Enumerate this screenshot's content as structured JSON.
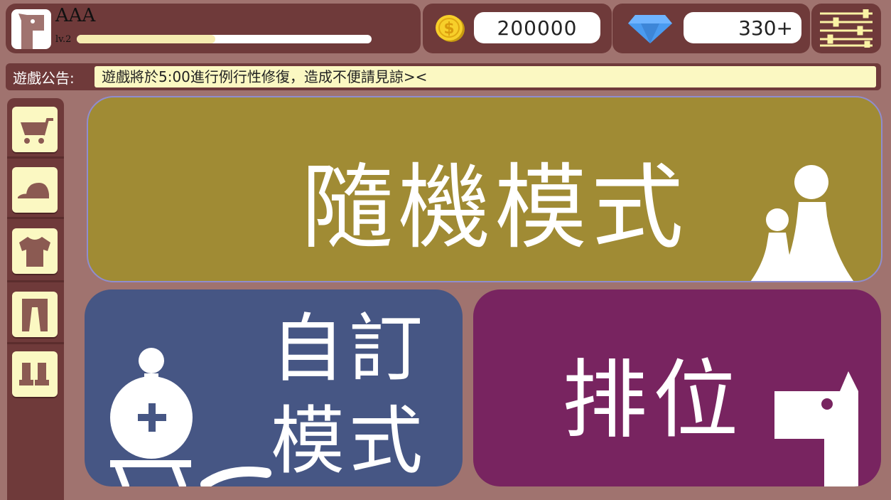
{
  "player": {
    "name": "AAA",
    "level_label": "lv.2",
    "xp_fraction": 0.47,
    "avatar_icon": "dog-head-icon"
  },
  "currency": {
    "coins": "200000",
    "coin_icon": "gold-coin-icon",
    "gems": "330+",
    "gem_icon": "blue-diamond-icon"
  },
  "settings_icon": "sliders-icon",
  "announcement": {
    "label": "遊戲公告:",
    "text": "遊戲將於5:00進行例行性修復，造成不便請見諒><"
  },
  "sidebar": {
    "items": [
      {
        "icon": "shopping-cart-icon"
      },
      {
        "icon": "cap-icon"
      },
      {
        "icon": "t-shirt-icon"
      },
      {
        "icon": "pants-icon"
      },
      {
        "icon": "boots-icon"
      }
    ]
  },
  "modes": {
    "random": {
      "label": "隨機模式",
      "icon": "pawns-icon",
      "color": "#a08b34"
    },
    "custom": {
      "label": "自訂模式",
      "icon": "king-piece-icon",
      "color": "#465684"
    },
    "ranked": {
      "label": "排位",
      "icon": "knight-horse-icon",
      "color": "#782460"
    }
  },
  "colors": {
    "background": "#a0736f",
    "panel": "#6f3a3a",
    "highlight": "#fbf8c2"
  }
}
